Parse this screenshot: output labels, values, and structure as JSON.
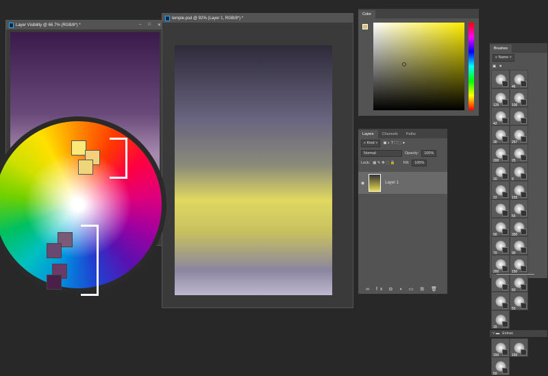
{
  "windows": [
    {
      "title": "Layer Visibility @ 66.7% (RGB/8*) *"
    },
    {
      "title": "temple.psd @ 92% (Layer 1, RGB/8*) *"
    }
  ],
  "color_panel": {
    "title": "Color",
    "hue": "#ffee00"
  },
  "layers_panel": {
    "tabs": [
      "Layers",
      "Channels",
      "Paths"
    ],
    "filter": "Kind",
    "blend_mode": "Normal",
    "opacity_label": "Opacity:",
    "opacity": "100%",
    "lock_label": "Lock:",
    "fill_label": "Fill:",
    "fill": "100%",
    "layers": [
      {
        "name": "Layer 1"
      }
    ],
    "footer_icons": [
      "link",
      "fx",
      "mask",
      "adjustment",
      "group",
      "new",
      "delete"
    ]
  },
  "brushes_panel": {
    "title": "Brushes",
    "search": "Name",
    "sizes": [
      "",
      "46",
      "125",
      "100",
      "42",
      "",
      "30",
      "257",
      "200",
      "25",
      "20",
      "9",
      "22",
      "155",
      "",
      "55",
      "90",
      "300",
      "70",
      "90",
      "200",
      "150",
      "",
      "50",
      "",
      "50",
      "15"
    ],
    "group": "Extras",
    "extras": [
      "150",
      "150",
      "50"
    ]
  },
  "colors": {
    "accent": "#31a8ff"
  }
}
